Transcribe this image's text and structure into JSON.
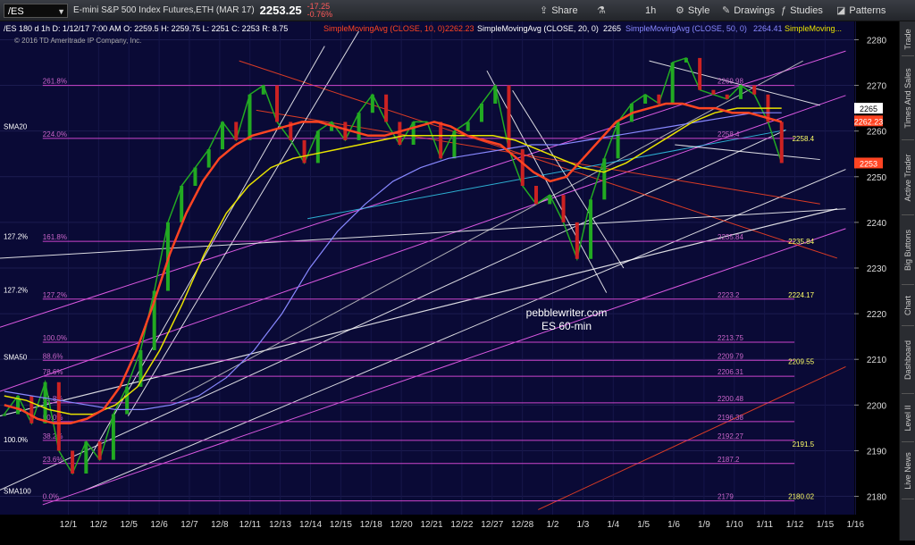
{
  "toolbar": {
    "symbol": "/ES",
    "description": "E-mini S&P 500 Index Futures,ETH (MAR 17)",
    "last": "2253.25",
    "net_change": "-17.25",
    "pct_change": "-0.76%",
    "share": "Share",
    "interval": "1h",
    "style": "Style",
    "drawings": "Drawings",
    "studies": "Studies",
    "patterns": "Patterns"
  },
  "sidebar": {
    "tabs": [
      "Trade",
      "Times And Sales",
      "Active Trader",
      "Big Buttons",
      "Chart",
      "Dashboard",
      "Level II",
      "Live News"
    ]
  },
  "header": {
    "line1": "/ES 180 d 1h  D: 1/12/17 7:00 AM  O: 2259.5  H: 2259.75  L: 2251  C: 2253  R: 8.75",
    "study1": "SimpleMovingAvg (CLOSE, 10, 0)",
    "study1_val": "2262.23",
    "study2": "SimpleMovingAvg (CLOSE, 20, 0)",
    "study2_val": "2265",
    "study3": "SimpleMovingAvg (CLOSE, 50, 0)",
    "study3_val": "2264.41",
    "study4": "SimpleMoving...",
    "copyright": "© 2016 TD Ameritrade IP Company, Inc."
  },
  "watermark": {
    "line1": "pebblewriter.com",
    "line2": "ES 60-min"
  },
  "colors": {
    "background": "#0a0a36",
    "sma10": "#ff4422",
    "sma20": "#e8e200",
    "sma50": "#8888ff",
    "fib": "#cc44cc",
    "channel": "#ffffff",
    "up_candle": "#22aa22",
    "down_candle": "#cc2222"
  },
  "chart_data": {
    "type": "line",
    "ylim": [
      2176,
      2284
    ],
    "yticks": [
      2180,
      2190,
      2200,
      2210,
      2220,
      2230,
      2240,
      2250,
      2260,
      2270,
      2280
    ],
    "xticks": [
      "12/1",
      "12/2",
      "12/5",
      "12/6",
      "12/7",
      "12/8",
      "12/11",
      "12/13",
      "12/14",
      "12/15",
      "12/18",
      "12/20",
      "12/21",
      "12/22",
      "12/27",
      "12/28",
      "1/2",
      "1/3",
      "1/4",
      "1/5",
      "1/6",
      "1/9",
      "1/10",
      "1/11",
      "1/12",
      "1/15",
      "1/16"
    ],
    "price_series": {
      "name": "ES",
      "values": [
        2198,
        2202,
        2196,
        2205,
        2190,
        2185,
        2192,
        2188,
        2198,
        2204,
        2212,
        2225,
        2240,
        2248,
        2252,
        2256,
        2262,
        2258,
        2268,
        2270,
        2262,
        2258,
        2253,
        2260,
        2262,
        2258,
        2264,
        2268,
        2262,
        2257,
        2262,
        2262,
        2254,
        2260,
        2262,
        2266,
        2270,
        2256,
        2248,
        2244,
        2246,
        2240,
        2232,
        2245,
        2254,
        2262,
        2266,
        2268,
        2266,
        2275,
        2276,
        2269,
        2268,
        2267,
        2270,
        2268,
        2262,
        2253
      ]
    },
    "sma10": {
      "name": "SimpleMovingAvg (CLOSE, 10, 0)",
      "values": [
        2200,
        2199,
        2197,
        2196,
        2196,
        2197,
        2199,
        2204,
        2212,
        2222,
        2233,
        2242,
        2249,
        2254,
        2257,
        2259,
        2260,
        2261,
        2262,
        2262,
        2261,
        2260,
        2259,
        2259,
        2260,
        2261,
        2262,
        2261,
        2259,
        2258,
        2257,
        2254,
        2251,
        2249,
        2250,
        2254,
        2258,
        2262,
        2264,
        2265,
        2266,
        2266,
        2265,
        2265,
        2264,
        2264,
        2263,
        2262
      ]
    },
    "sma20": {
      "name": "SimpleMovingAvg (CLOSE, 20, 0)",
      "values": [
        2202,
        2201,
        2199,
        2198,
        2198,
        2200,
        2204,
        2212,
        2222,
        2233,
        2242,
        2248,
        2252,
        2254,
        2255,
        2256,
        2257,
        2258,
        2259,
        2259,
        2259,
        2259,
        2259,
        2258,
        2256,
        2254,
        2252,
        2251,
        2253,
        2256,
        2259,
        2262,
        2264,
        2265,
        2265,
        2265
      ]
    },
    "sma50": {
      "name": "SimpleMovingAvg (CLOSE, 50, 0)",
      "values": [
        2203,
        2202,
        2201,
        2200,
        2199,
        2199,
        2200,
        2202,
        2206,
        2212,
        2220,
        2230,
        2238,
        2244,
        2249,
        2252,
        2254,
        2255,
        2256,
        2257,
        2257,
        2258,
        2259,
        2260,
        2261,
        2262,
        2263,
        2264,
        2264
      ]
    },
    "price_labels": [
      {
        "text": "2265",
        "value": 2265,
        "color": "#ffffff"
      },
      {
        "text": "2262.23",
        "value": 2262.23,
        "color": "#ff4422"
      },
      {
        "text": "2253",
        "value": 2253,
        "color": "#ff4422"
      }
    ],
    "right_labels": [
      {
        "text": "2258.4",
        "value": 2258.4
      },
      {
        "text": "2235.84",
        "value": 2235.84
      },
      {
        "text": "2224.17",
        "value": 2224.17
      },
      {
        "text": "2209.55",
        "value": 2209.55
      },
      {
        "text": "2191.5",
        "value": 2191.5
      },
      {
        "text": "2180.02",
        "value": 2180.02
      }
    ],
    "fib_levels": [
      {
        "pct": "261.8%",
        "value": 2269.98,
        "label": "2269.98"
      },
      {
        "pct": "224.0%",
        "value": 2258.4,
        "label": "2258.4"
      },
      {
        "pct": "161.8%",
        "value": 2235.84,
        "label": "2235.84"
      },
      {
        "pct": "127.2%",
        "value": 2223.2,
        "label": "2223.2"
      },
      {
        "pct": "100.0%",
        "value": 2213.75,
        "label": "2213.75"
      },
      {
        "pct": "88.6%",
        "value": 2209.79,
        "label": "2209.79"
      },
      {
        "pct": "78.6%",
        "value": 2206.31,
        "label": "2206.31"
      },
      {
        "pct": "61.8%",
        "value": 2200.48,
        "label": "2200.48"
      },
      {
        "pct": "50.0%",
        "value": 2196.38,
        "label": "2196.38"
      },
      {
        "pct": "38.2%",
        "value": 2192.27,
        "label": "2192.27"
      },
      {
        "pct": "23.6%",
        "value": 2187.2,
        "label": "2187.2"
      },
      {
        "pct": "0.0%",
        "value": 2179,
        "label": "2179"
      }
    ],
    "left_labels": [
      {
        "text": "SMA20",
        "value": 2260
      },
      {
        "text": "127.2%",
        "value": 2236
      },
      {
        "text": "127.2%",
        "value": 2224.2
      },
      {
        "text": "SMA50",
        "value": 2209.6
      },
      {
        "text": "100.0%",
        "value": 2191.5
      },
      {
        "text": "SMA100",
        "value": 2180.2
      }
    ]
  }
}
